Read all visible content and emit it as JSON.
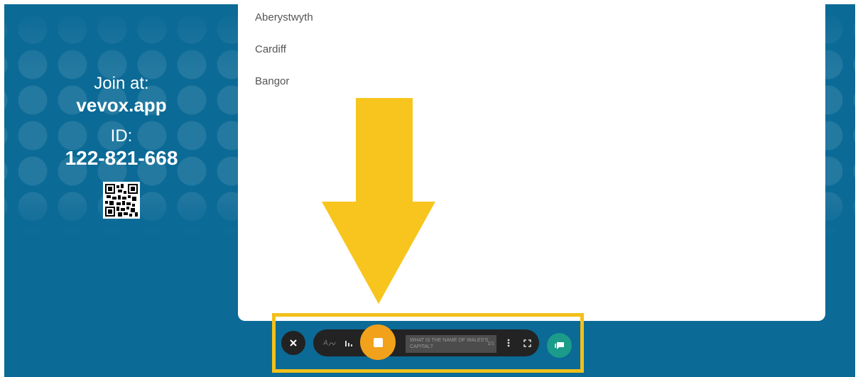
{
  "join_panel": {
    "join_label": "Join at:",
    "join_url": "vevox.app",
    "id_label": "ID:",
    "id_value": "122-821-668"
  },
  "poll": {
    "options": [
      "Aberystwyth",
      "Cardiff",
      "Bangor"
    ]
  },
  "toolbar": {
    "close_icon": "close-icon",
    "font_icon": "text-size-icon",
    "results_icon": "bar-chart-icon",
    "stop_icon": "stop-icon",
    "question_text": "WHAT IS THE NAME OF WALES'S CAPITAL?",
    "question_number": "1/1",
    "more_icon": "more-vertical-icon",
    "fullscreen_icon": "fullscreen-icon",
    "chat_icon": "chat-icon"
  },
  "colors": {
    "background": "#0b6a96",
    "highlight": "#f2c01a",
    "arrow": "#f7c51d",
    "stop": "#f2a11b",
    "chat": "#1b9b8a"
  }
}
